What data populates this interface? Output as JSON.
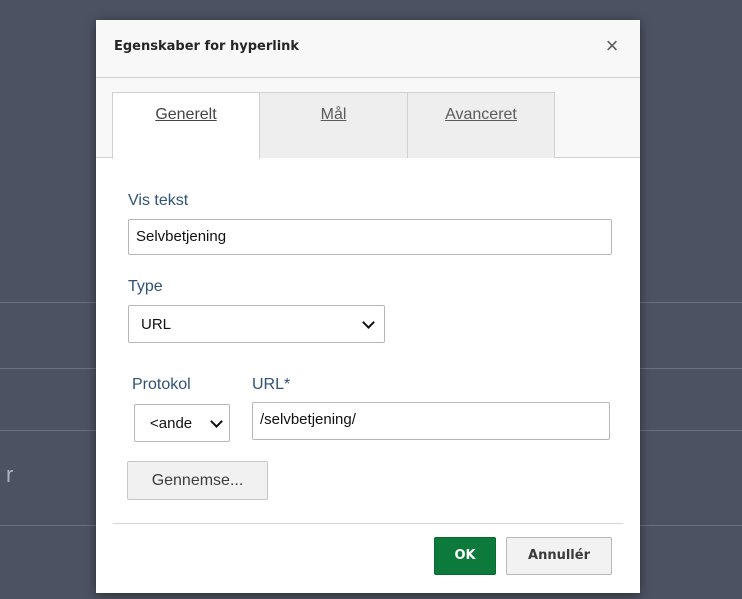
{
  "background": {
    "partial_text": "r"
  },
  "dialog": {
    "title": "Egenskaber for hyperlink",
    "close_label": "×",
    "tabs": [
      {
        "label": "Generelt",
        "active": true
      },
      {
        "label": "Mål",
        "active": false
      },
      {
        "label": "Avanceret",
        "active": false
      }
    ],
    "fields": {
      "display_text": {
        "label": "Vis tekst",
        "value": "Selvbetjening"
      },
      "type": {
        "label": "Type",
        "value": "URL"
      },
      "protocol": {
        "label": "Protokol",
        "value": "<ande"
      },
      "url": {
        "label": "URL*",
        "value": "/selvbetjening/"
      }
    },
    "browse_label": "Gennemse...",
    "ok_label": "OK",
    "cancel_label": "Annullér"
  },
  "colors": {
    "ok_button": "#0c7a3b",
    "label_text": "#2f5378",
    "backdrop": "#4b5262"
  }
}
